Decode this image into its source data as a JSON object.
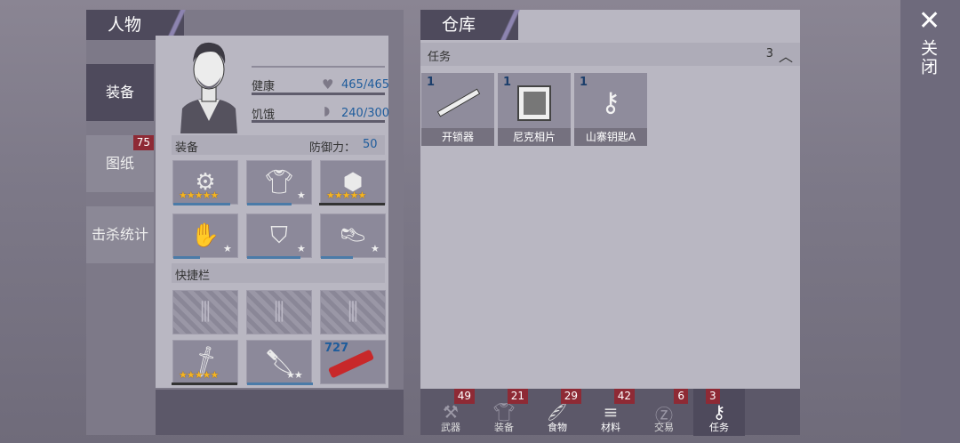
{
  "left": {
    "title": "人物",
    "tabs": [
      {
        "label": "装备"
      },
      {
        "label": "图纸",
        "badge": "75"
      },
      {
        "label": "击杀统计"
      }
    ],
    "stats": {
      "health_label": "健康",
      "health_value": "465/465",
      "hunger_label": "饥饿",
      "hunger_value": "240/300"
    },
    "equip_label": "装备",
    "defense_label": "防御力：",
    "defense_value": "50",
    "quickbar_label": "快捷栏",
    "quick_item_count": "727"
  },
  "storage": {
    "title": "仓库",
    "section_label": "任务",
    "section_count": "3",
    "items": [
      {
        "count": "1",
        "name": "开锁器"
      },
      {
        "count": "1",
        "name": "尼克相片"
      },
      {
        "count": "1",
        "name": "山寨钥匙A"
      }
    ],
    "tabs": [
      {
        "label": "武器",
        "badge": "49"
      },
      {
        "label": "装备",
        "badge": "21"
      },
      {
        "label": "食物",
        "badge": "29"
      },
      {
        "label": "材料",
        "badge": "42"
      },
      {
        "label": "交易",
        "badge": "6"
      },
      {
        "label": "任务",
        "badge": "3"
      }
    ]
  },
  "close": {
    "label": "关闭"
  }
}
